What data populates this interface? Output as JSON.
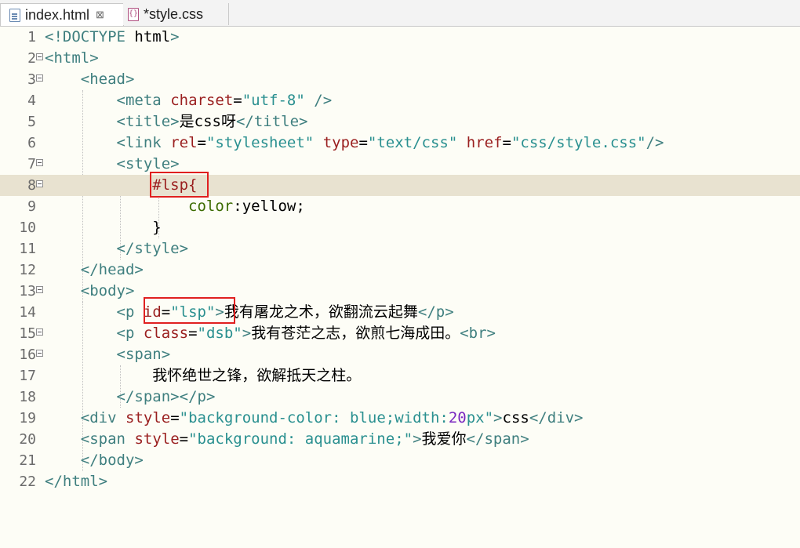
{
  "tabs": [
    {
      "label": "index.html",
      "close": "⊠"
    },
    {
      "label": "*style.css"
    }
  ],
  "lines": [
    {
      "n": "1",
      "code": "<!DOCTYPE html>"
    },
    {
      "n": "2",
      "code": "<html>"
    },
    {
      "n": "3",
      "code": "    <head>"
    },
    {
      "n": "4",
      "code": "        <meta charset=\"utf-8\" />"
    },
    {
      "n": "5",
      "code": "        <title>是css呀</title>"
    },
    {
      "n": "6",
      "code": "        <link rel=\"stylesheet\" type=\"text/css\" href=\"css/style.css\"/>"
    },
    {
      "n": "7",
      "code": "        <style>"
    },
    {
      "n": "8",
      "code": "            #lsp{"
    },
    {
      "n": "9",
      "code": "                color:yellow;"
    },
    {
      "n": "10",
      "code": "            }"
    },
    {
      "n": "11",
      "code": "        </style>"
    },
    {
      "n": "12",
      "code": "    </head>"
    },
    {
      "n": "13",
      "code": "    <body>"
    },
    {
      "n": "14",
      "code": "        <p id=\"lsp\">我有屠龙之术，欲翻流云起舞</p>"
    },
    {
      "n": "15",
      "code": "        <p class=\"dsb\">我有苍茫之志，欲煎七海成田。<br>"
    },
    {
      "n": "16",
      "code": "        <span>"
    },
    {
      "n": "17",
      "code": "            我怀绝世之锋，欲解抵天之柱。"
    },
    {
      "n": "18",
      "code": "        </span></p>"
    },
    {
      "n": "19",
      "code": "    <div style=\"background-color: blue;width:20px\">css</div>"
    },
    {
      "n": "20",
      "code": "    <span style=\"background: aquamarine;\">我爱你</span>"
    },
    {
      "n": "21",
      "code": "    </body>"
    },
    {
      "n": "22",
      "code": "</html>"
    }
  ],
  "colors": {
    "tag": "#3f7f7f",
    "attr": "#9a1f1f",
    "value": "#2a9090",
    "highlight": "#e02020"
  }
}
